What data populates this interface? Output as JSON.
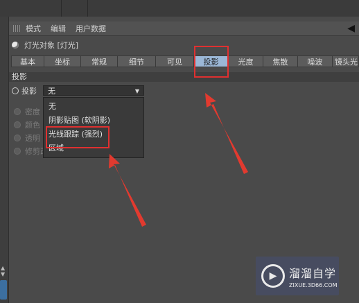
{
  "menu": {
    "items": [
      "模式",
      "编辑",
      "用户数据"
    ]
  },
  "object": {
    "title": "灯光对象 [灯光]"
  },
  "tabs": [
    "基本",
    "坐标",
    "常规",
    "细节",
    "可见",
    "投影",
    "光度",
    "焦散",
    "噪波",
    "镜头光"
  ],
  "section": {
    "title": "投影"
  },
  "shadow": {
    "label": "投影",
    "selected": "无"
  },
  "dropdown": {
    "options": [
      "无",
      "阴影贴图 (软阴影)",
      "光线跟踪 (强烈)",
      "区域"
    ]
  },
  "disabled_rows": [
    "密度",
    "颜色",
    "透明",
    "修剪改"
  ],
  "watermark": {
    "title": "溜溜自学",
    "url": "ZIXUE.3D66.COM"
  },
  "colors": {
    "annotation_red": "#e03030",
    "active_tab": "#9bb7d6"
  }
}
